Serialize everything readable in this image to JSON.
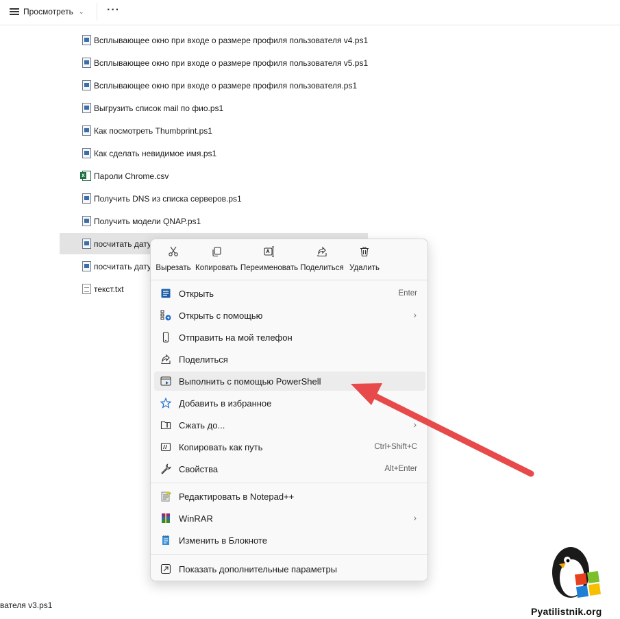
{
  "toolbar": {
    "view_label": "Просмотреть",
    "more_label": "···"
  },
  "files": [
    {
      "name": "Всплывающее окно при входе о размере профиля пользователя v4.ps1",
      "type": "ps1"
    },
    {
      "name": "Всплывающее окно при входе о размере профиля пользователя v5.ps1",
      "type": "ps1"
    },
    {
      "name": "Всплывающее окно при входе о размере профиля пользователя.ps1",
      "type": "ps1"
    },
    {
      "name": "Выгрузить список mail по фио.ps1",
      "type": "ps1"
    },
    {
      "name": "Как посмотреть Thumbprint.ps1",
      "type": "ps1"
    },
    {
      "name": "Как сделать невидимое имя.ps1",
      "type": "ps1"
    },
    {
      "name": "Пароли Chrome.csv",
      "type": "csv"
    },
    {
      "name": "Получить DNS из списка серверов.ps1",
      "type": "ps1"
    },
    {
      "name": "Получить модели QNAP.ps1",
      "type": "ps1"
    },
    {
      "name": "посчитать дату",
      "type": "ps1",
      "selected": true
    },
    {
      "name": "посчитать дату",
      "type": "ps1"
    },
    {
      "name": "текст.txt",
      "type": "txt"
    }
  ],
  "bottom_text": "вателя v3.ps1",
  "context_menu": {
    "quick_actions": [
      {
        "label": "Вырезать",
        "icon": "scissors-icon"
      },
      {
        "label": "Копировать",
        "icon": "copy-icon"
      },
      {
        "label": "Переименовать",
        "icon": "rename-icon"
      },
      {
        "label": "Поделиться",
        "icon": "share-icon"
      },
      {
        "label": "Удалить",
        "icon": "trash-icon"
      }
    ],
    "items": [
      {
        "label": "Открыть",
        "shortcut": "Enter",
        "icon": "open-icon"
      },
      {
        "label": "Открыть с помощью",
        "submenu": true,
        "icon": "open-with-icon"
      },
      {
        "label": "Отправить на мой телефон",
        "icon": "phone-icon"
      },
      {
        "label": "Поделиться",
        "icon": "share-icon"
      },
      {
        "label": "Выполнить с помощью PowerShell",
        "icon": "powershell-icon",
        "highlighted": true
      },
      {
        "label": "Добавить в избранное",
        "icon": "star-icon"
      },
      {
        "label": "Сжать до...",
        "submenu": true,
        "icon": "zip-icon"
      },
      {
        "label": "Копировать как путь",
        "shortcut": "Ctrl+Shift+C",
        "icon": "copy-path-icon"
      },
      {
        "label": "Свойства",
        "shortcut": "Alt+Enter",
        "icon": "wrench-icon"
      },
      {
        "label": "Редактировать в Notepad++",
        "icon": "notepadpp-icon"
      },
      {
        "label": "WinRAR",
        "submenu": true,
        "icon": "winrar-icon"
      },
      {
        "label": "Изменить в Блокноте",
        "icon": "notepad-icon"
      },
      {
        "label": "Показать дополнительные параметры",
        "icon": "more-options-icon"
      }
    ]
  },
  "watermark": {
    "text": "Pyatilistnik.org"
  },
  "colors": {
    "arrow": "#e8494a",
    "highlight": "#ececec",
    "selected_row": "#e3e3e3"
  }
}
